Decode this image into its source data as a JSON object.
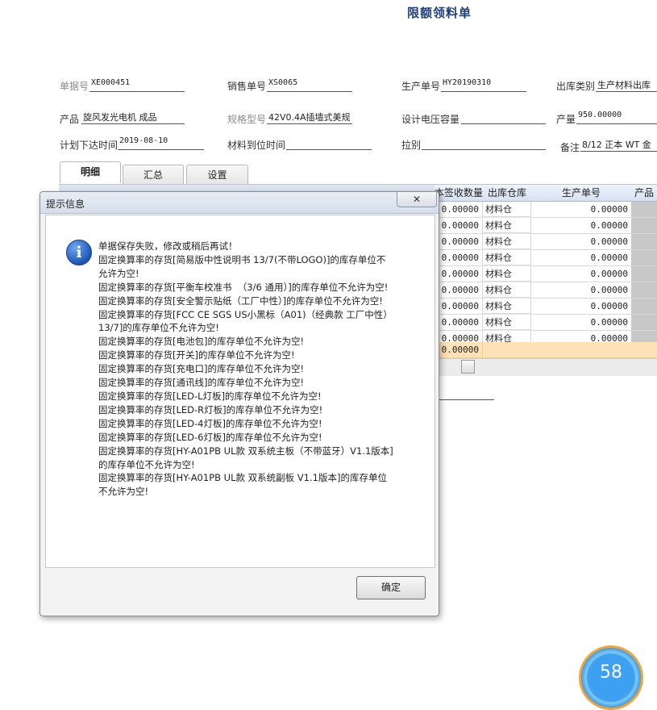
{
  "form": {
    "title": "限额领料单",
    "doc_no_label": "单据号",
    "doc_no": "XE000451",
    "sales_no_label": "销售单号",
    "sales_no": "XS0065",
    "prod_no_label": "生产单号",
    "prod_no": "HY20190310",
    "out_type_label": "出库类别",
    "out_type": "生产材料出库",
    "product_label": "产品",
    "product": "旋风发光电机  成品",
    "spec_label": "规格型号",
    "spec": "42V0.4A插墙式美规",
    "voltage_label": "设计电压容量",
    "voltage": "",
    "output_label": "产量",
    "output": "950.00000",
    "plan_date_label": "计划下达时间",
    "plan_date": "2019-08-10",
    "arrival_label": "材料到位时间",
    "arrival": "",
    "pull_label": "拉别",
    "pull": "",
    "remark_label": "备注",
    "remark": "8/12 正本 WT 金"
  },
  "tabs": [
    "明细",
    "汇总",
    "设置"
  ],
  "grid": {
    "headers": [
      "本签收数量",
      "出库仓库",
      "生产单号",
      "产品"
    ],
    "rows": [
      {
        "qty": "0.00000",
        "wh": "材料仓",
        "prod": "0.00000"
      },
      {
        "qty": "0.00000",
        "wh": "材料仓",
        "prod": "0.00000"
      },
      {
        "qty": "0.00000",
        "wh": "材料仓",
        "prod": "0.00000"
      },
      {
        "qty": "0.00000",
        "wh": "材料仓",
        "prod": "0.00000"
      },
      {
        "qty": "0.00000",
        "wh": "材料仓",
        "prod": "0.00000"
      },
      {
        "qty": "0.00000",
        "wh": "材料仓",
        "prod": "0.00000"
      },
      {
        "qty": "0.00000",
        "wh": "材料仓",
        "prod": "0.00000"
      },
      {
        "qty": "0.00000",
        "wh": "材料仓",
        "prod": "0.00000"
      },
      {
        "qty": "0.00000",
        "wh": "材料仓",
        "prod": "0.00000"
      }
    ],
    "total": "0.00000"
  },
  "dialog": {
    "title": "提示信息",
    "close": "✕",
    "ok": "确定",
    "lines": [
      "单据保存失败，修改或稍后再试！",
      "固定换算率的存货[简易版中性说明书 13/7(不带LOGO)]的库存单位不\n允许为空!",
      "固定换算率的存货[平衡车校准书  （3/6 通用）]的库存单位不允许为空!",
      "固定换算率的存货[安全警示贴纸（工厂中性）]的库存单位不允许为空!",
      "固定换算率的存货[FCC CE SGS US小黑标（A01)（经典款 工厂中性）\n13/7]的库存单位不允许为空!",
      "固定换算率的存货[电池包]的库存单位不允许为空!",
      "固定换算率的存货[开关]的库存单位不允许为空!",
      "固定换算率的存货[充电口]的库存单位不允许为空!",
      "固定换算率的存货[通讯线]的库存单位不允许为空!",
      "固定换算率的存货[LED-L灯板]的库存单位不允许为空!",
      "固定换算率的存货[LED-R灯板]的库存单位不允许为空!",
      "固定换算率的存货[LED-4灯板]的库存单位不允许为空!",
      "固定换算率的存货[LED-6灯板]的库存单位不允许为空!",
      "固定换算率的存货[HY-A01PB UL款 双系统主板（不带蓝牙）V1.1版本]\n的库存单位不允许为空!",
      "固定换算率的存货[HY-A01PB UL款 双系统副板 V1.1版本]的库存单位\n不允许为空!"
    ]
  },
  "widget": {
    "text": "58"
  }
}
